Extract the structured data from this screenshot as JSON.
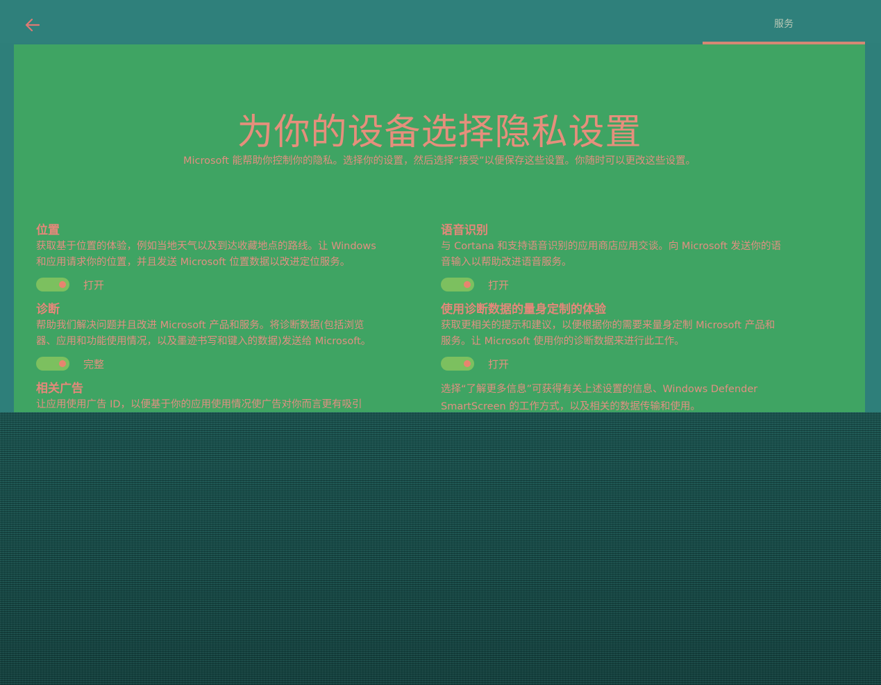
{
  "header": {
    "back_icon": "arrow-left-icon",
    "tab_label": "服务"
  },
  "colors": {
    "background": "#2e7f7a",
    "panel": "#3fa463",
    "accent_text": "#e5887a",
    "toggle_on": "#7cc05f"
  },
  "main": {
    "title": "为你的设备选择隐私设置",
    "subtitle": "Microsoft 能帮助你控制你的隐私。选择你的设置，然后选择“接受”以便保存这些设置。你随时可以更改这些设置。"
  },
  "settings": {
    "location": {
      "title": "位置",
      "desc_lines": [
        "获取基于位置的体验，例如当地天气以及到达收藏地点的路线。让 Windows",
        "和应用请求你的位置，并且发送 Microsoft 位置数据以改进定位服务。"
      ],
      "state": "打开"
    },
    "diagnostics": {
      "title": "诊断",
      "desc_lines": [
        "帮助我们解决问题并且改进 Microsoft 产品和服务。将诊断数据(包括浏览",
        "器、应用和功能使用情况，以及墨迹书写和键入的数据)发送给 Microsoft。"
      ],
      "state": "完整"
    },
    "ads": {
      "title": "相关广告",
      "desc_lines": [
        "让应用使用广告 ID，以便基于你的应用使用情况使广告对你而言更有吸引"
      ]
    },
    "speech": {
      "title": "语音识别",
      "desc_lines": [
        "与 Cortana 和支持语音识别的应用商店应用交谈。向 Microsoft 发送你的语",
        "音输入以帮助改进语音服务。"
      ],
      "state": "打开"
    },
    "tailored": {
      "title": "使用诊断数据的量身定制的体验",
      "desc_lines": [
        "获取更相关的提示和建议，以便根据你的需要来量身定制 Microsoft 产品和",
        "服务。让 Microsoft 使用你的诊断数据来进行此工作。"
      ],
      "state": "打开"
    },
    "more_info": {
      "lines": [
        "选择“了解更多信息”可获得有关上述设置的信息、Windows Defender",
        "SmartScreen 的工作方式，以及相关的数据传输和使用。"
      ]
    }
  }
}
